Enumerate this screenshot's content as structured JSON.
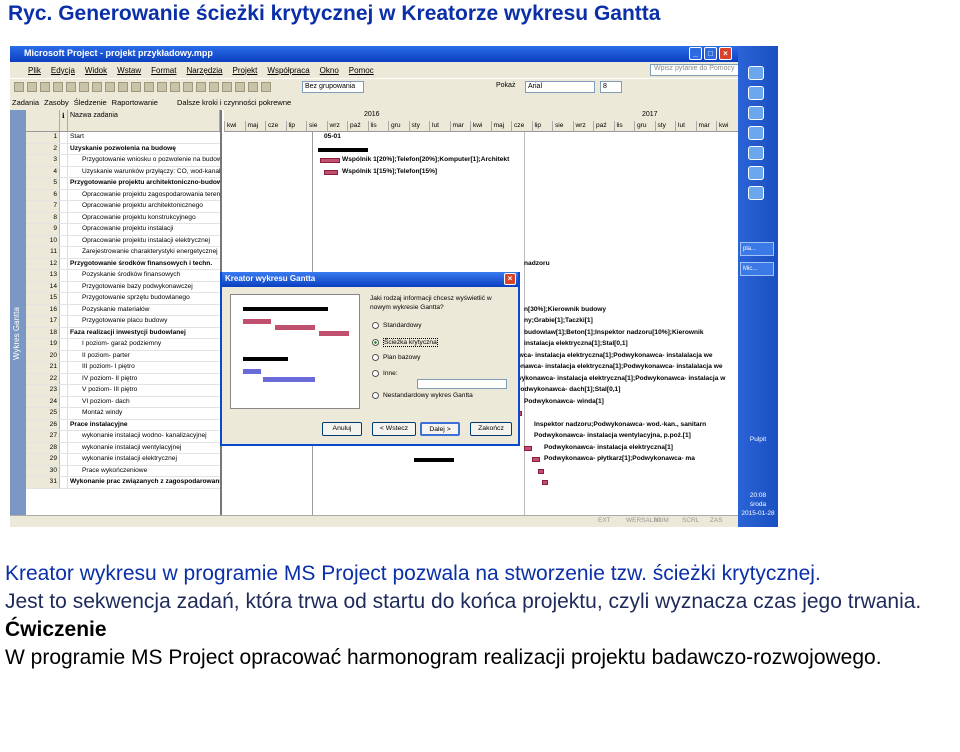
{
  "page_title": "Ryc. Generowanie ścieżki krytycznej w Kreatorze wykresu Gantta",
  "window": {
    "title": "Microsoft Project - projekt przykładowy.mpp",
    "menu": [
      "Plik",
      "Edycja",
      "Widok",
      "Wstaw",
      "Format",
      "Narzędzia",
      "Projekt",
      "Współpraca",
      "Okno",
      "Pomoc"
    ],
    "help_placeholder": "Wpisz pytanie do Pomocy",
    "toolbar": {
      "group_select": "Bez grupowania",
      "show_label": "Pokaż",
      "font_select": "Arial",
      "font_size": "8"
    },
    "toolbar2": [
      "Zadania",
      "Zasoby",
      "Śledzenie",
      "Raportowanie",
      "Dalsze kroki i czynności pokrewne"
    ],
    "viewbar_label": "Wykres Gantta",
    "table_header": "Nazwa zadania",
    "rows": [
      {
        "id": "1",
        "name": "Start",
        "bold": false
      },
      {
        "id": "2",
        "name": "Uzyskanie pozwolenia na budowę",
        "bold": true
      },
      {
        "id": "3",
        "name": "Przygotowanie wniosku o pozwolenie na budowę",
        "bold": false
      },
      {
        "id": "4",
        "name": "Uzyskanie warunków przyłączy: CO, wod-kanal., energii elek.",
        "bold": false
      },
      {
        "id": "5",
        "name": "Przygotowanie projektu architektoniczno-budowlanego",
        "bold": true
      },
      {
        "id": "6",
        "name": "Opracowanie projektu zagospodarowania terenu",
        "bold": false
      },
      {
        "id": "7",
        "name": "Opracowanie projektu architektonicznego",
        "bold": false
      },
      {
        "id": "8",
        "name": "Opracowanie projektu konstrukcyjnego",
        "bold": false
      },
      {
        "id": "9",
        "name": "Opracowanie projektu instalacji",
        "bold": false
      },
      {
        "id": "10",
        "name": "Opracowanie projektu instalacji elektrycznej",
        "bold": false
      },
      {
        "id": "11",
        "name": "Zarejestrowanie charakterystyki energetycznej",
        "bold": false
      },
      {
        "id": "12",
        "name": "Przygotowanie środków finansowych i techn.",
        "bold": true
      },
      {
        "id": "13",
        "name": "Pozyskanie środków finansowych",
        "bold": false
      },
      {
        "id": "14",
        "name": "Przygotowanie bazy podwykonawczej",
        "bold": false
      },
      {
        "id": "15",
        "name": "Przygotowanie sprzętu budowlanego",
        "bold": false
      },
      {
        "id": "16",
        "name": "Pozyskanie materiałów",
        "bold": false
      },
      {
        "id": "17",
        "name": "Przygotowanie placu budowy",
        "bold": false
      },
      {
        "id": "18",
        "name": "Faza realizacji inwestycji budowlanej",
        "bold": true
      },
      {
        "id": "19",
        "name": "I poziom- garaż podziemny",
        "bold": false
      },
      {
        "id": "20",
        "name": "II poziom- parter",
        "bold": false
      },
      {
        "id": "21",
        "name": "III poziom- I piętro",
        "bold": false
      },
      {
        "id": "22",
        "name": "IV poziom- II piętro",
        "bold": false
      },
      {
        "id": "23",
        "name": "V poziom- III piętro",
        "bold": false
      },
      {
        "id": "24",
        "name": "VI poziom- dach",
        "bold": false
      },
      {
        "id": "25",
        "name": "Montaż windy",
        "bold": false
      },
      {
        "id": "26",
        "name": "Prace instalacyjne",
        "bold": true
      },
      {
        "id": "27",
        "name": "wykonanie instalacji wodno- kanalizacyjnej",
        "bold": false
      },
      {
        "id": "28",
        "name": "wykonanie instalacji wentylacyjnej",
        "bold": false
      },
      {
        "id": "29",
        "name": "wykonanie instalacji elektrycznej",
        "bold": false
      },
      {
        "id": "30",
        "name": "Prace wykończeniowe",
        "bold": false
      },
      {
        "id": "31",
        "name": "Wykonanie prac związanych z zagospodarowaniem terenu",
        "bold": true
      }
    ],
    "gantt": {
      "years": [
        "2016",
        "2017"
      ],
      "months": [
        "kwi",
        "maj",
        "cze",
        "lip",
        "sie",
        "wrz",
        "paź",
        "lis",
        "gru",
        "sty",
        "lut",
        "mar",
        "kwi",
        "maj",
        "cze",
        "lip",
        "sie",
        "wrz",
        "paź",
        "lis",
        "gru",
        "sty",
        "lut",
        "mar",
        "kwi"
      ],
      "labels": [
        "05-01",
        "Wspólnik 1[20%];Telefon[20%];Komputer[1];Architekt",
        "Wspólnik 1[15%];Telefon[15%]",
        "nadzoru",
        "n[30%];Kierownik budowy",
        "ny;Grabie[1];Taczki[1]",
        "budowlaw[1];Beton[1];Inspektor nadzoru[10%];Kierownik",
        "instalacja elektryczna[1];Stal[0,1]",
        "Podwykonawca- instalacja elektryczna[1];Podwykonawca- instalalacja we",
        "Podwykonawca- instalacja elektryczna[1];Podwykonawca- instalalacja we",
        "Podwykonawca- instalacja elektryczna[1];Podwykonawca- instalacja w",
        "Podwykonawca- dach[1];Stal[0,1]",
        "Podwykonawca- winda[1]",
        "Inspektor nadzoru;Podwykonawca- wod.-kan., sanitarn",
        "Podwykonawca- instalacja wentylacyjna, p.poż.[1]",
        "Podwykonawca- instalacja elektryczna[1]",
        "Podwykonawca- płytkarz[1];Podwykonawca- ma"
      ]
    },
    "dialog": {
      "title": "Kreator wykresu Gantta",
      "question": "Jaki rodzaj informacji chcesz wyświetlić w nowym wykresie Gantta?",
      "options": [
        "Standardowy",
        "Ścieżka krytyczna",
        "Plan bazowy",
        "Inne:",
        "Nestandardowy wykres Gantta"
      ],
      "selected": "Ścieżka krytyczna",
      "buttons": {
        "cancel": "Anuluj",
        "back": "< Wstecz",
        "next": "Dalej >",
        "finish": "Zakończ"
      }
    },
    "statusbar": [
      "EXT",
      "WERSALIKI",
      "NUM",
      "SCRL",
      "ZAS"
    ],
    "taskbar": {
      "apps": [
        "pla...",
        "Mic..."
      ],
      "lang": "Pulpit",
      "time": "20:08",
      "day": "środa",
      "date": "2015-01-28"
    }
  },
  "text": {
    "line1": "Kreator wykresu w programie MS Project pozwala na stworzenie tzw. ścieżki krytycznej.",
    "line2": "Jest to sekwencja zadań, która trwa od startu do końca projektu, czyli wyznacza czas jego trwania.",
    "exercise_title": "Ćwiczenie",
    "exercise_text": "W programie MS Project opracować harmonogram realizacji projektu badawczo-rozwojowego."
  }
}
